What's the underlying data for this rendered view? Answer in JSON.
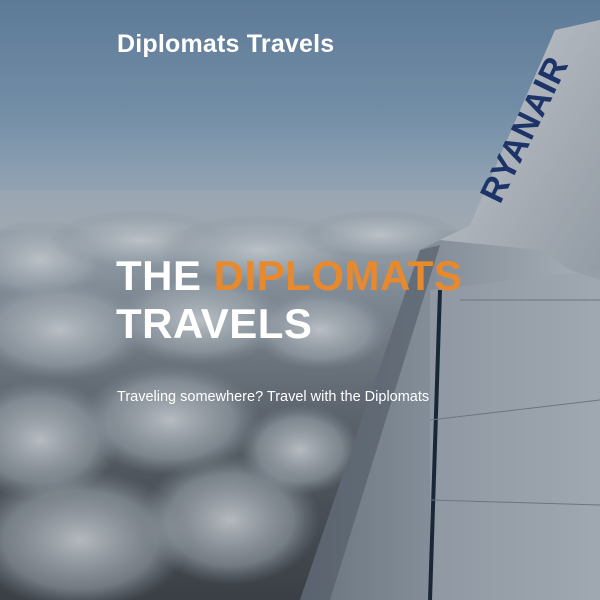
{
  "header": {
    "brand": "Diplomats Travels"
  },
  "hero": {
    "headline_part1": "THE",
    "headline_accent": "DIPLOMATS",
    "headline_part2": "TRAVELS",
    "subtitle": "Traveling somewhere? Travel with the Diplomats",
    "wing_logo": "RYANAIR",
    "background_image": "airplane-wing-above-clouds"
  },
  "colors": {
    "accent": "#e8892e",
    "text": "#ffffff",
    "wing_logo": "#1f3a78"
  }
}
